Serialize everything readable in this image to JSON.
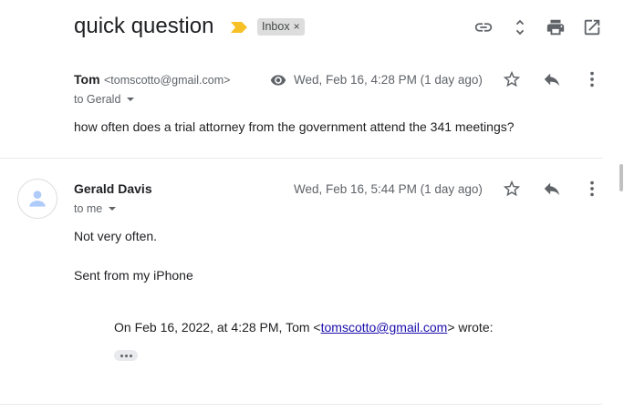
{
  "thread": {
    "subject": "quick question",
    "label": "Inbox",
    "label_remove": "×"
  },
  "toolbar": {
    "icons": [
      "link-icon",
      "expand-collapse-icon",
      "print-icon",
      "open-in-new-window-icon"
    ]
  },
  "messages": [
    {
      "sender_name": "Tom",
      "sender_email": "<tomscotto@gmail.com>",
      "recipient": "to Gerald",
      "date": "Wed, Feb 16, 4:28 PM (1 day ago)",
      "body": "how often does a trial attorney from the government attend the 341 meetings?"
    },
    {
      "sender_name": "Gerald Davis",
      "recipient": "to me",
      "date": "Wed, Feb 16, 5:44 PM (1 day ago)",
      "body_line1": "Not very often.",
      "body_line2": "Sent from my iPhone",
      "quote_prefix": "On Feb 16, 2022, at 4:28 PM, Tom <",
      "quote_email": "tomscotto@gmail.com",
      "quote_suffix": "> wrote:"
    }
  ],
  "colors": {
    "importance_marker": "#f6c026",
    "label_chip_bg": "#dddddd",
    "link": "#1a0dab",
    "avatar_icon": "#aecbfa"
  }
}
